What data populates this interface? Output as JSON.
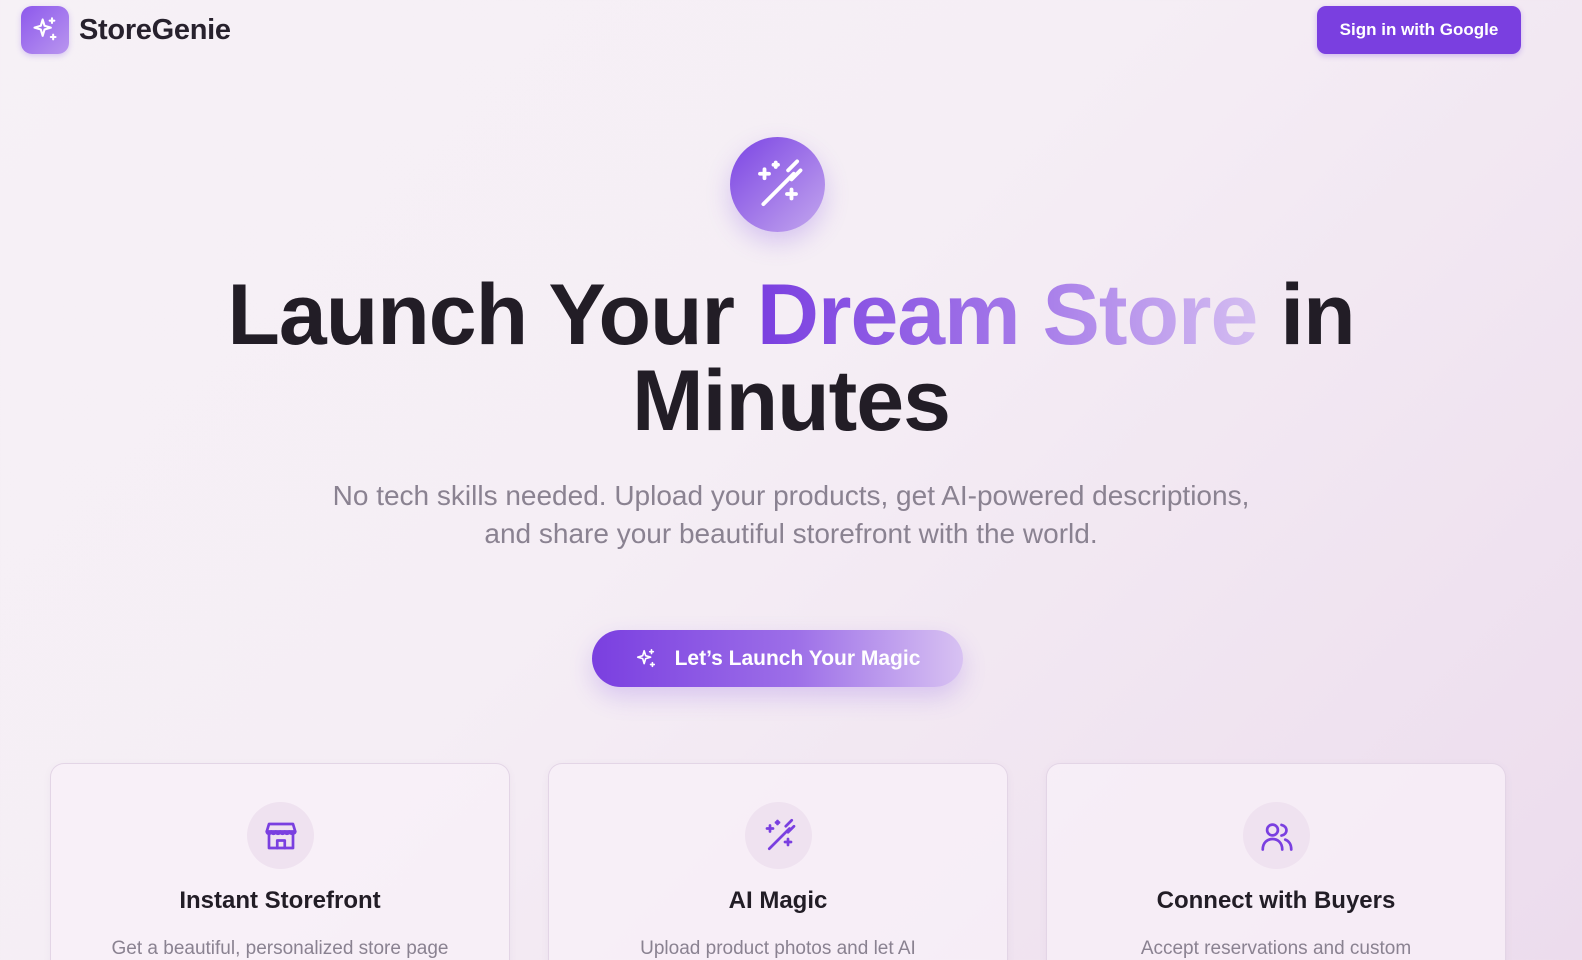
{
  "header": {
    "brand": "StoreGenie",
    "logo_icon": "sparkles-icon",
    "signin_label": "Sign in with Google"
  },
  "hero": {
    "icon": "magic-wand-icon",
    "title_part1": "Launch Your ",
    "title_highlight": "Dream Store",
    "title_part2": " in Minutes",
    "subtitle": "No tech skills needed. Upload your products, get AI-powered descriptions, and share your beautiful storefront with the world.",
    "cta_label": "Let’s Launch Your Magic",
    "cta_icon": "sparkles-icon"
  },
  "features": [
    {
      "icon": "store-icon",
      "title": "Instant Storefront",
      "description": "Get a beautiful, personalized store page"
    },
    {
      "icon": "magic-wand-icon",
      "title": "AI Magic",
      "description": "Upload product photos and let AI"
    },
    {
      "icon": "users-icon",
      "title": "Connect with Buyers",
      "description": "Accept reservations and custom"
    }
  ],
  "colors": {
    "accent": "#7a3fe0",
    "accent_light": "#c3a7ee",
    "background": "#f5eef5",
    "heading": "#221d26",
    "muted_text": "#8a8291"
  }
}
